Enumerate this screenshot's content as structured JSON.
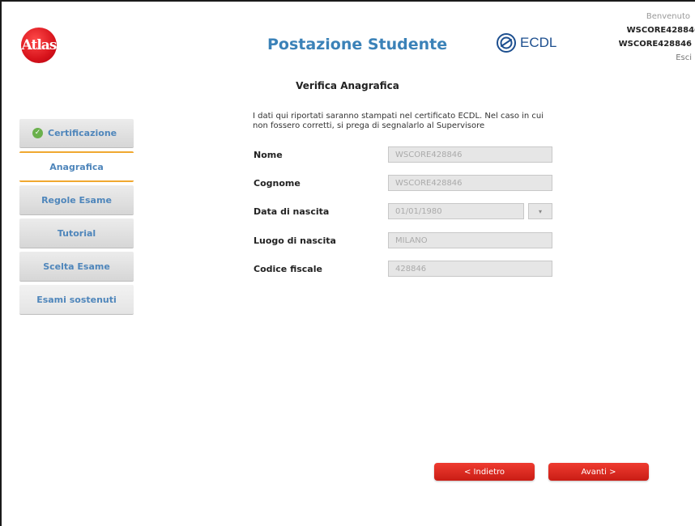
{
  "header": {
    "logo_text": "Atlas",
    "app_title": "Postazione Studente",
    "ecdl_label": "ECDL",
    "welcome": "Benvenuto",
    "user_line1": "WSCORE428846",
    "user_line2": "WSCORE428846",
    "logout": "Esci"
  },
  "section_title": "Verifica Anagrafica",
  "notice": "I dati qui riportati saranno stampati nel certificato ECDL. Nel caso in cui non fossero corretti, si prega di segnalarlo al Supervisore",
  "sidebar": {
    "items": [
      {
        "label": "Certificazione",
        "state": "completed",
        "icon": "check-icon"
      },
      {
        "label": "Anagrafica",
        "state": "active"
      },
      {
        "label": "Regole Esame",
        "state": "default"
      },
      {
        "label": "Tutorial",
        "state": "default"
      },
      {
        "label": "Scelta Esame",
        "state": "default"
      },
      {
        "label": "Esami sostenuti",
        "state": "default"
      }
    ]
  },
  "form": {
    "nome": {
      "label": "Nome",
      "value": "WSCORE428846"
    },
    "cognome": {
      "label": "Cognome",
      "value": "WSCORE428846"
    },
    "data_nascita": {
      "label": "Data di nascita",
      "value": "01/01/1980",
      "picker_icon": "chevron-down-icon"
    },
    "luogo_nascita": {
      "label": "Luogo di nascita",
      "value": "MILANO"
    },
    "codice_fiscale": {
      "label": "Codice fiscale",
      "value": "428846"
    }
  },
  "buttons": {
    "back": "< Indietro",
    "next": "Avanti >"
  },
  "colors": {
    "accent_blue": "#3b82b8",
    "button_red": "#e0281e",
    "active_step_border": "#f0a830",
    "check_green": "#6ab04c"
  }
}
